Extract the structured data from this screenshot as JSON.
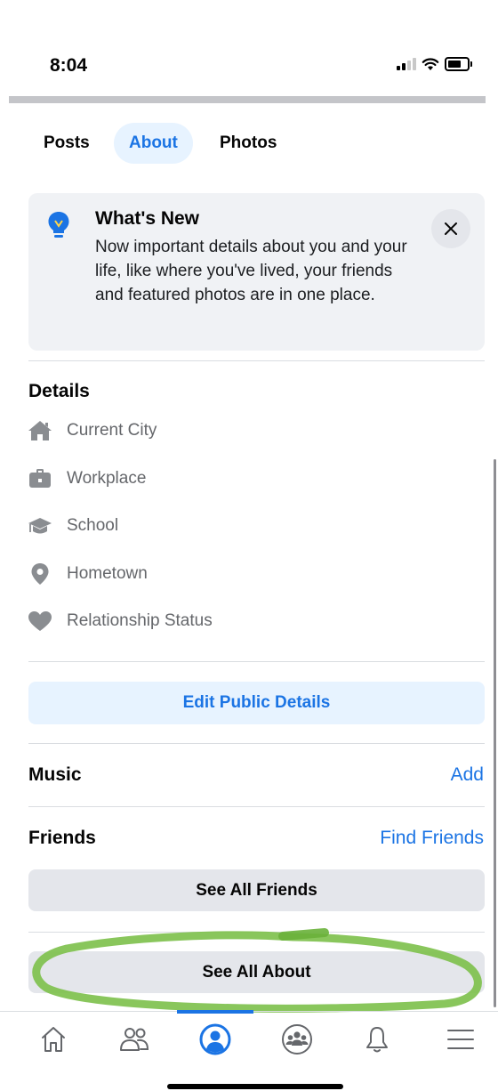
{
  "status_bar": {
    "time": "8:04"
  },
  "tabs": [
    {
      "label": "Posts",
      "active": false
    },
    {
      "label": "About",
      "active": true
    },
    {
      "label": "Photos",
      "active": false
    }
  ],
  "whats_new": {
    "title": "What's New",
    "body": "Now important details about you and your life, like where you've lived, your friends and featured photos are in one place."
  },
  "details": {
    "title": "Details",
    "items": [
      {
        "label": "Current City",
        "icon": "house-icon"
      },
      {
        "label": "Workplace",
        "icon": "briefcase-icon"
      },
      {
        "label": "School",
        "icon": "graduation-cap-icon"
      },
      {
        "label": "Hometown",
        "icon": "location-pin-icon"
      },
      {
        "label": "Relationship Status",
        "icon": "heart-icon"
      }
    ],
    "edit_button": "Edit Public Details"
  },
  "music": {
    "title": "Music",
    "action": "Add"
  },
  "friends": {
    "title": "Friends",
    "action": "Find Friends",
    "see_all": "See All Friends"
  },
  "about": {
    "see_all": "See All About"
  },
  "bottom_nav": [
    {
      "icon": "home-icon",
      "active": false
    },
    {
      "icon": "friends-icon",
      "active": false
    },
    {
      "icon": "profile-icon",
      "active": true
    },
    {
      "icon": "groups-icon",
      "active": false
    },
    {
      "icon": "bell-icon",
      "active": false
    },
    {
      "icon": "menu-icon",
      "active": false
    }
  ],
  "colors": {
    "accent": "#1b74e4",
    "accent_light": "#e7f3ff",
    "card_bg": "#f0f2f5",
    "button_gray": "#e4e6eb",
    "highlight_marker": "#7cc04a"
  }
}
